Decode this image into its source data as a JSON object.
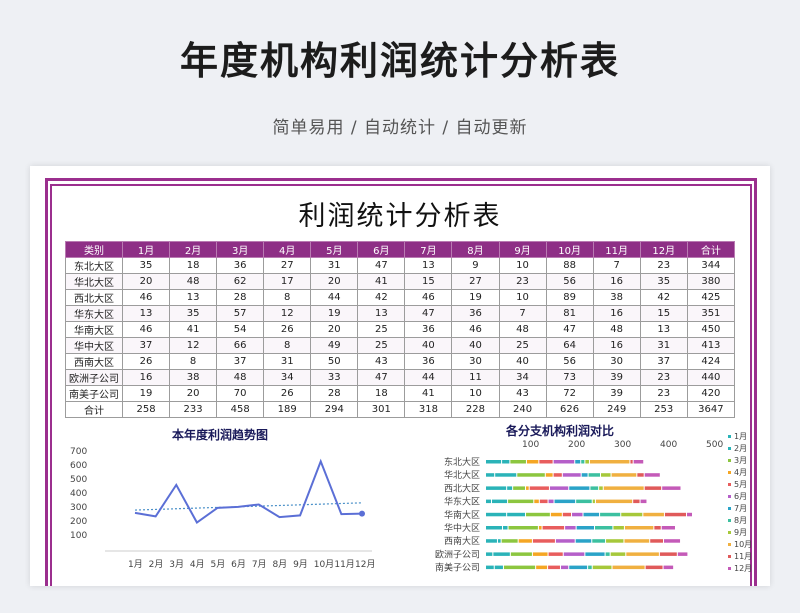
{
  "header": {
    "title": "年度机构利润统计分析表",
    "subtitle": "简单易用 / 自动统计 / 自动更新"
  },
  "sheet": {
    "title": "利润统计分析表",
    "columns": [
      "类别",
      "1月",
      "2月",
      "3月",
      "4月",
      "5月",
      "6月",
      "7月",
      "8月",
      "9月",
      "10月",
      "11月",
      "12月",
      "合计"
    ],
    "rows": [
      [
        "东北大区",
        "35",
        "18",
        "36",
        "27",
        "31",
        "47",
        "13",
        "9",
        "10",
        "88",
        "7",
        "23",
        "344"
      ],
      [
        "华北大区",
        "20",
        "48",
        "62",
        "17",
        "20",
        "41",
        "15",
        "27",
        "23",
        "56",
        "16",
        "35",
        "380"
      ],
      [
        "西北大区",
        "46",
        "13",
        "28",
        "8",
        "44",
        "42",
        "46",
        "19",
        "10",
        "89",
        "38",
        "42",
        "425"
      ],
      [
        "华东大区",
        "13",
        "35",
        "57",
        "12",
        "19",
        "13",
        "47",
        "36",
        "7",
        "81",
        "16",
        "15",
        "351"
      ],
      [
        "华南大区",
        "46",
        "41",
        "54",
        "26",
        "20",
        "25",
        "36",
        "46",
        "48",
        "47",
        "48",
        "13",
        "450"
      ],
      [
        "华中大区",
        "37",
        "12",
        "66",
        "8",
        "49",
        "25",
        "40",
        "40",
        "25",
        "64",
        "16",
        "31",
        "413"
      ],
      [
        "西南大区",
        "26",
        "8",
        "37",
        "31",
        "50",
        "43",
        "36",
        "30",
        "40",
        "56",
        "30",
        "37",
        "424"
      ],
      [
        "欧洲子公司",
        "16",
        "38",
        "48",
        "34",
        "33",
        "47",
        "44",
        "11",
        "34",
        "73",
        "39",
        "23",
        "440"
      ],
      [
        "南美子公司",
        "19",
        "20",
        "70",
        "26",
        "28",
        "18",
        "41",
        "10",
        "43",
        "72",
        "39",
        "23",
        "420"
      ],
      [
        "合计",
        "258",
        "233",
        "458",
        "189",
        "294",
        "301",
        "318",
        "228",
        "240",
        "626",
        "249",
        "253",
        "3647"
      ]
    ]
  },
  "chart_data": [
    {
      "type": "line",
      "title": "本年度利润趋势图",
      "categories": [
        "1月",
        "2月",
        "3月",
        "4月",
        "5月",
        "6月",
        "7月",
        "8月",
        "9月",
        "10月",
        "11月",
        "12月"
      ],
      "series": [
        {
          "values": [
            258,
            233,
            458,
            189,
            294,
            301,
            318,
            228,
            240,
            626,
            249,
            253
          ]
        }
      ],
      "ylim": [
        0,
        700
      ],
      "yticks": [
        "100",
        "200",
        "300",
        "400",
        "500",
        "600",
        "700"
      ],
      "trendline": true,
      "colors": {
        "line": "#5b6fd6",
        "trend": "#4a90c8"
      }
    },
    {
      "type": "bar",
      "orientation": "horizontal",
      "stacked": true,
      "title": "各分支机构利润对比",
      "categories": [
        "东北大区",
        "华北大区",
        "西北大区",
        "华东大区",
        "华南大区",
        "华中大区",
        "西南大区",
        "欧洲子公司",
        "南美子公司"
      ],
      "xticks": [
        "100",
        "200",
        "300",
        "400",
        "500"
      ],
      "xlim": [
        0,
        500
      ],
      "legend_position": "right",
      "series": [
        {
          "name": "1月",
          "values": [
            35,
            20,
            46,
            13,
            46,
            37,
            26,
            16,
            19
          ],
          "color": "#2ab3b8"
        },
        {
          "name": "2月",
          "values": [
            18,
            48,
            13,
            35,
            41,
            12,
            8,
            38,
            20
          ],
          "color": "#2ab3b8"
        },
        {
          "name": "3月",
          "values": [
            36,
            62,
            28,
            57,
            54,
            66,
            37,
            48,
            70
          ],
          "color": "#8cc63f"
        },
        {
          "name": "4月",
          "values": [
            27,
            17,
            8,
            12,
            26,
            8,
            31,
            34,
            26
          ],
          "color": "#f5a623"
        },
        {
          "name": "5月",
          "values": [
            31,
            20,
            44,
            19,
            20,
            49,
            50,
            33,
            28
          ],
          "color": "#e85d5d"
        },
        {
          "name": "6月",
          "values": [
            47,
            41,
            42,
            13,
            25,
            25,
            43,
            47,
            18
          ],
          "color": "#b55fc9"
        },
        {
          "name": "7月",
          "values": [
            13,
            15,
            46,
            47,
            36,
            40,
            36,
            44,
            41
          ],
          "color": "#2aa3c8"
        },
        {
          "name": "8月",
          "values": [
            9,
            27,
            19,
            36,
            46,
            40,
            30,
            11,
            10
          ],
          "color": "#3cc0a0"
        },
        {
          "name": "9月",
          "values": [
            10,
            23,
            10,
            7,
            48,
            25,
            40,
            34,
            43
          ],
          "color": "#a6c83a"
        },
        {
          "name": "10月",
          "values": [
            88,
            56,
            89,
            81,
            47,
            64,
            56,
            73,
            72
          ],
          "color": "#f0b040"
        },
        {
          "name": "11月",
          "values": [
            7,
            16,
            38,
            16,
            48,
            16,
            30,
            39,
            39
          ],
          "color": "#e05a5a"
        },
        {
          "name": "12月",
          "values": [
            23,
            35,
            42,
            15,
            13,
            31,
            37,
            23,
            23
          ],
          "color": "#c45ab8"
        }
      ]
    }
  ]
}
